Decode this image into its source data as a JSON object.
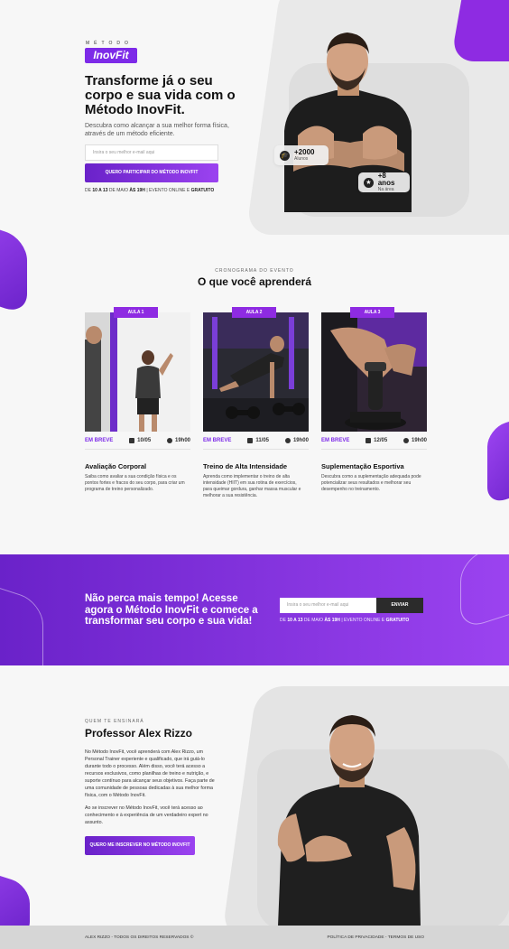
{
  "hero": {
    "logo_small": "MÉTODO",
    "logo_brand": "InovFit",
    "title": "Transforme já o seu corpo e sua vida com o Método InovFit.",
    "subtitle": "Descubra como alcançar a sua melhor forma física, através de um método eficiente.",
    "email_placeholder": "Insira o seu melhor e-mail aqui",
    "cta_label": "QUERO PARTICIPAR DO MÉTODO INOVFIT",
    "date_prefix": "DE",
    "date_range": "10 A 13",
    "date_month": "DE MAIO",
    "date_time": "ÀS 19H",
    "date_separator": "|",
    "date_suffix": "EVENTO ONLINE E",
    "date_free": "GRATUITO",
    "badge_students_value": "+2000",
    "badge_students_label": "Alunos",
    "badge_years_value": "+8 anos",
    "badge_years_label": "Na área"
  },
  "schedule": {
    "eyebrow": "CRONOGRAMA DO EVENTO",
    "title": "O que você aprenderá",
    "cards": [
      {
        "tag": "AULA 1",
        "status": "EM BREVE",
        "date": "10/05",
        "time": "19h00",
        "title": "Avaliação Corporal",
        "description": "Saiba como avaliar a sua condição física e os pontos fortes e fracos do seu corpo, para criar um programa de treino personalizado."
      },
      {
        "tag": "AULA 2",
        "status": "EM BREVE",
        "date": "11/05",
        "time": "19h00",
        "title": "Treino de Alta Intensidade",
        "description": "Aprenda como implementar o treino de alta intensidade (HIIT) em sua rotina de exercícios, para queimar gordura, ganhar massa muscular e melhorar a sua resistência."
      },
      {
        "tag": "AULA 3",
        "status": "EM BREVE",
        "date": "12/05",
        "time": "19h00",
        "title": "Suplementação Esportiva",
        "description": "Descubra como a suplementação adequada pode potencializar seus resultados e melhorar seu desempenho no treinamento."
      }
    ]
  },
  "cta_band": {
    "title": "Não perca mais tempo! Acesse agora o Método InovFit e comece a transformar seu corpo e sua vida!",
    "email_placeholder": "Insira o seu melhor e-mail aqui",
    "button_label": "ENVIAR",
    "date_prefix": "DE",
    "date_range": "10 A 13",
    "date_month": "DE MAIO",
    "date_time": "ÀS 19H",
    "date_separator": "|",
    "date_suffix": "EVENTO ONLINE E",
    "date_free": "GRATUITO"
  },
  "professor": {
    "eyebrow": "QUEM TE ENSINARÁ",
    "name": "Professor Alex Rizzo",
    "paragraph_1": "No Método InovFit, você aprenderá com Alex Rizzo, um Personal Trainer experiente e qualificado, que irá guiá-lo durante todo o processo. Além disso, você terá acesso a recursos exclusivos, como planilhas de treino e nutrição, e suporte contínuo para alcançar seus objetivos. Faça parte de uma comunidade de pessoas dedicadas à sua melhor forma física, com o Método InovFit.",
    "paragraph_2": "Ao se inscrever no Método InovFit, você terá acesso ao conhecimento e à experiência de um verdadeiro expert no assunto.",
    "cta_label": "QUERO ME INSCREVER NO MÉTODO INOVFIT"
  },
  "footer": {
    "copyright": "ALEX RIZZO - TODOS OS DIREITOS RESERVADOS ©",
    "links": "POLÍTICA DE PRIVACIDADE - TERMOS DE USO"
  },
  "colors": {
    "accent": "#7d2ae8",
    "accent_light": "#9b43f0",
    "dark": "#2b2b2b"
  }
}
